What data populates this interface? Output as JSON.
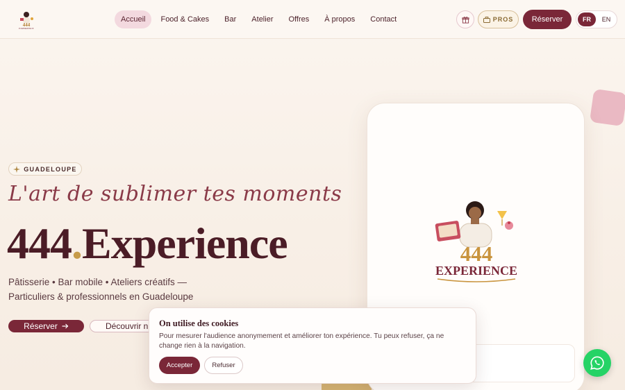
{
  "nav": {
    "logo_text": "444 EXPERIENCE",
    "menu": [
      {
        "label": "Accueil",
        "active": true
      },
      {
        "label": "Food & Cakes",
        "active": false
      },
      {
        "label": "Bar",
        "active": false
      },
      {
        "label": "Atelier",
        "active": false
      },
      {
        "label": "Offres",
        "active": false
      },
      {
        "label": "À propos",
        "active": false
      },
      {
        "label": "Contact",
        "active": false
      }
    ],
    "gift_icon": "gift-icon",
    "pros_label": "PROS",
    "pros_icon": "briefcase-icon",
    "reserve_label": "Réserver",
    "lang": [
      "FR",
      "EN"
    ],
    "lang_active": "FR"
  },
  "hero": {
    "badge_label": "GUADELOUPE",
    "badge_icon": "sparkle-icon",
    "script_title": "L'art de sublimer tes moments",
    "brand_number": "444",
    "brand_dot": ".",
    "brand_name": "Experience",
    "subtitle_line1": "Pâtisserie • Bar mobile • Ateliers créatifs —",
    "subtitle_line2": "Particuliers & professionnels en Guadeloupe",
    "reserve_label": "Réserver",
    "reserve_icon": "arrow-right-icon",
    "discover_label": "Découvrir n"
  },
  "card": {
    "logo_number": "444",
    "logo_name": "EXPERIENCE"
  },
  "cookie": {
    "title": "On utilise des cookies",
    "text": "Pour mesurer l'audience anonymement et améliorer ton expérience. Tu peux refuser, ça ne change rien à la navigation.",
    "accept_label": "Accepter",
    "refuse_label": "Refuser"
  },
  "whatsapp_icon": "whatsapp-icon",
  "colors": {
    "primary": "#7a2738",
    "gold": "#c79b4a",
    "pink": "#f3d9df",
    "whatsapp": "#25d366"
  }
}
